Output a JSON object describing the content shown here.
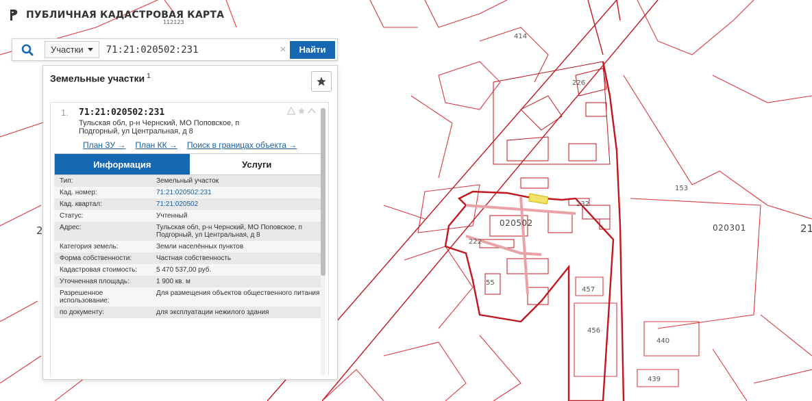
{
  "app": {
    "title": "ПУБЛИЧНАЯ КАДАСТРОВАЯ КАРТА"
  },
  "search": {
    "type_label": "Участки",
    "query": "71:21:020502:231",
    "find_label": "Найти",
    "clear_symbol": "×"
  },
  "panel": {
    "title": "Земельные участки",
    "count": "1",
    "result": {
      "index": "1.",
      "cad_number": "71:21:020502:231",
      "address": "Тульская обл, р-н Чернский, МО Поповское, п Подгорный, ул Центральная, д 8",
      "links": [
        "План ЗУ →",
        "План КК →",
        "Поиск в границах объекта →"
      ],
      "tabs": [
        {
          "label": "Информация",
          "active": true
        },
        {
          "label": "Услуги",
          "active": false
        }
      ],
      "info": [
        {
          "label": "Тип:",
          "value": "Земельный участок",
          "link": false
        },
        {
          "label": "Кад. номер:",
          "value": "71:21:020502:231",
          "link": true
        },
        {
          "label": "Кад. квартал:",
          "value": "71:21:020502",
          "link": true
        },
        {
          "label": "Статус:",
          "value": "Учтенный",
          "link": false
        },
        {
          "label": "Адрес:",
          "value": "Тульская обл, р-н Чернский, МО Поповское, п Подгорный, ул Центральная, д 8",
          "link": false
        },
        {
          "label": "Категория земель:",
          "value": "Земли населённых пунктов",
          "link": false
        },
        {
          "label": "Форма собственности:",
          "value": "Частная собственность",
          "link": false
        },
        {
          "label": "Кадастровая стоимость:",
          "value": "5 470 537,00 руб.",
          "link": false
        },
        {
          "label": "Уточненная площадь:",
          "value": "1 900 кв. м",
          "link": false
        },
        {
          "label": "Разрешенное использование:",
          "value": "Для размещения объектов общественного питания",
          "link": false
        },
        {
          "label": "по документу:",
          "value": "для эксплуатации нежилого здания",
          "link": false
        }
      ]
    }
  },
  "map": {
    "labels": [
      "414",
      "153",
      "020301",
      "21",
      "020502",
      "232",
      "222",
      "457",
      "456",
      "440",
      "439",
      "226",
      "55",
      "112123",
      "2"
    ]
  },
  "colors": {
    "accent": "#1768b3",
    "parcel_line": "#c0161f",
    "highlight": "#f2e36b"
  }
}
